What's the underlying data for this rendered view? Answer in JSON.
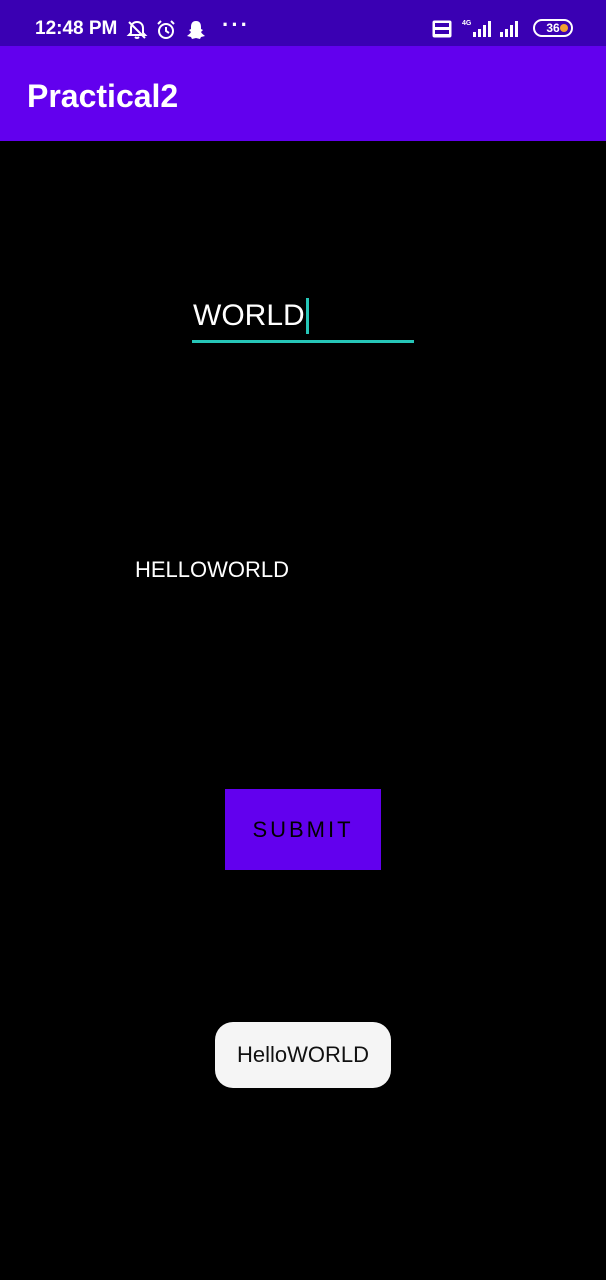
{
  "status_bar": {
    "time": "12:48 PM",
    "icons": [
      "notifications-off-icon",
      "alarm-icon",
      "snapchat-icon",
      "more-icon"
    ],
    "more": "···",
    "network": "4G",
    "battery": "36",
    "color": "#3a00b3"
  },
  "app_bar": {
    "title": "Practical2",
    "color": "#6200ee"
  },
  "main": {
    "input_value": "WORLD",
    "accent_color": "#26c6b8",
    "result_text": "HELLOWORLD",
    "submit_label": "SUBMIT"
  },
  "toast": {
    "message": "HelloWORLD"
  }
}
